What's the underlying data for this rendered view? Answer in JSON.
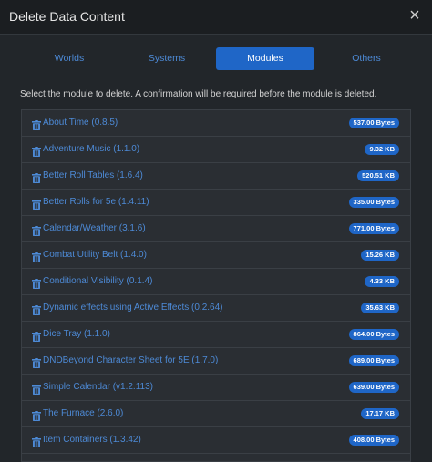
{
  "dialog": {
    "title": "Delete Data Content",
    "close_glyph": "×"
  },
  "tabs": [
    {
      "label": "Worlds",
      "active": false
    },
    {
      "label": "Systems",
      "active": false
    },
    {
      "label": "Modules",
      "active": true
    },
    {
      "label": "Others",
      "active": false
    }
  ],
  "instruction": "Select the module to delete. A confirmation will be required before the module is deleted.",
  "icons": {
    "row_icon": "trash-icon",
    "close_icon": "close-icon"
  },
  "colors": {
    "accent": "#1f66c7",
    "link": "#4d8ad6"
  },
  "modules": [
    {
      "label": "About Time (0.8.5)",
      "size": "537.00 Bytes"
    },
    {
      "label": "Adventure Music (1.1.0)",
      "size": "9.32 KB"
    },
    {
      "label": "Better Roll Tables (1.6.4)",
      "size": "520.51 KB"
    },
    {
      "label": "Better Rolls for 5e (1.4.11)",
      "size": "335.00 Bytes"
    },
    {
      "label": "Calendar/Weather (3.1.6)",
      "size": "771.00 Bytes"
    },
    {
      "label": "Combat Utility Belt (1.4.0)",
      "size": "15.26 KB"
    },
    {
      "label": "Conditional Visibility (0.1.4)",
      "size": "4.33 KB"
    },
    {
      "label": "Dynamic effects using Active Effects (0.2.64)",
      "size": "35.63 KB"
    },
    {
      "label": "Dice Tray (1.1.0)",
      "size": "864.00 Bytes"
    },
    {
      "label": "DNDBeyond Character Sheet for 5E (1.7.0)",
      "size": "689.00 Bytes"
    },
    {
      "label": "Simple Calendar (v1.2.113)",
      "size": "639.00 Bytes"
    },
    {
      "label": "The Furnace (2.6.0)",
      "size": "17.17 KB"
    },
    {
      "label": "Item Containers (1.3.42)",
      "size": "408.00 Bytes"
    }
  ]
}
